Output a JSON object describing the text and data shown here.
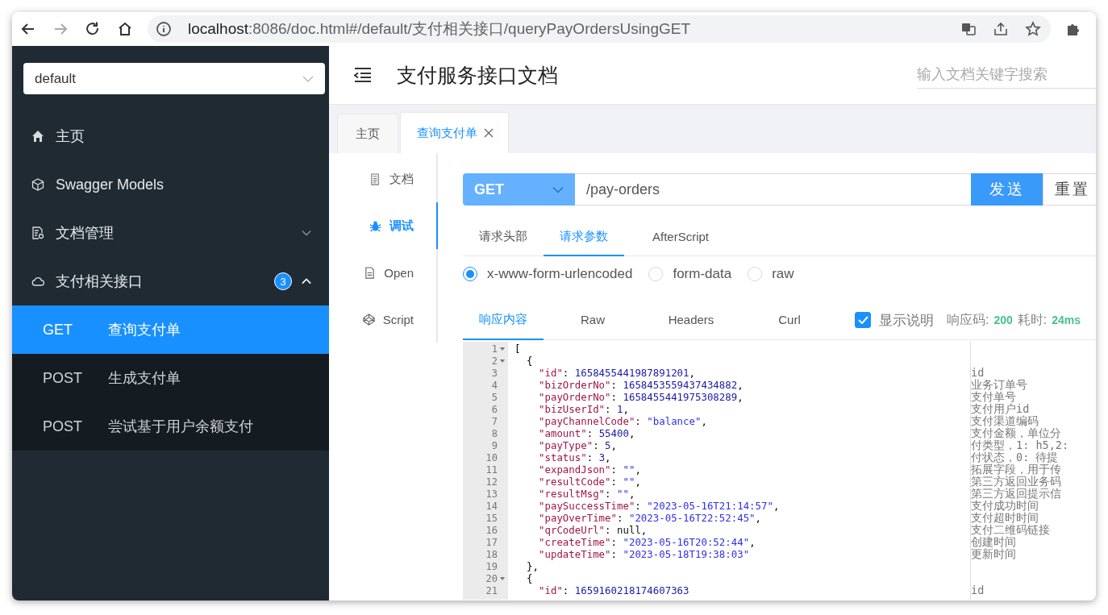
{
  "browser": {
    "url_host": "localhost",
    "url_rest": ":8086/doc.html#/default/支付相关接口/queryPayOrdersUsingGET"
  },
  "sidebar": {
    "group_select": "default",
    "menu": [
      {
        "label": "主页"
      },
      {
        "label": "Swagger Models"
      },
      {
        "label": "文档管理",
        "expanded": false
      },
      {
        "label": "支付相关接口",
        "badge": "3",
        "expanded": true,
        "children": [
          {
            "method": "GET",
            "label": "查询支付单",
            "selected": true
          },
          {
            "method": "POST",
            "label": "生成支付单",
            "selected": false
          },
          {
            "method": "POST",
            "label": "尝试基于用户余额支付",
            "selected": false
          }
        ]
      }
    ]
  },
  "header": {
    "title": "支付服务接口文档",
    "search_placeholder": "输入文档关键字搜索"
  },
  "tabs": [
    {
      "label": "主页",
      "selected": false,
      "closable": false
    },
    {
      "label": "查询支付单",
      "selected": true,
      "closable": true
    }
  ],
  "side_tabs": [
    {
      "label": "文档",
      "selected": false
    },
    {
      "label": "调试",
      "selected": true
    },
    {
      "label": "Open",
      "selected": false
    },
    {
      "label": "Script",
      "selected": false
    }
  ],
  "request": {
    "method": "GET",
    "path": "/pay-orders",
    "buttons": [
      {
        "label": "发送",
        "kind": "primary"
      },
      {
        "label": "重置",
        "kind": "default"
      }
    ],
    "tabs": [
      {
        "label": "请求头部",
        "selected": false
      },
      {
        "label": "请求参数",
        "selected": true
      },
      {
        "label": "AfterScript",
        "selected": false
      }
    ],
    "body_types": [
      {
        "label": "x-www-form-urlencoded",
        "selected": true
      },
      {
        "label": "form-data",
        "selected": false
      },
      {
        "label": "raw",
        "selected": false
      }
    ]
  },
  "response": {
    "tabs": [
      {
        "label": "响应内容",
        "selected": true
      },
      {
        "label": "Raw",
        "selected": false
      },
      {
        "label": "Headers",
        "selected": false
      },
      {
        "label": "Curl",
        "selected": false
      }
    ],
    "show_notes": {
      "label": "显示说明",
      "checked": true
    },
    "status_label": "响应码:",
    "status": "200",
    "time_label": "耗时:",
    "time": "24ms",
    "lines": [
      {
        "number": "1",
        "fold": true,
        "kind": "bracket",
        "tokens": [
          {
            "kind": "plain",
            "text": "["
          }
        ]
      },
      {
        "number": "2",
        "fold": true,
        "kind": "brace",
        "tokens": [
          {
            "kind": "plain",
            "text": "{"
          }
        ]
      },
      {
        "number": "3",
        "fold": false,
        "kind": "field",
        "tokens": [
          {
            "kind": "key",
            "text": "\"id\""
          },
          {
            "kind": "plain",
            "text": ":"
          },
          {
            "kind": "number",
            "text": "1658455441987891201"
          },
          {
            "kind": "plain",
            "text": ","
          }
        ],
        "note": "id"
      },
      {
        "number": "4",
        "fold": false,
        "kind": "field",
        "tokens": [
          {
            "kind": "key",
            "text": "\"bizOrderNo\""
          },
          {
            "kind": "plain",
            "text": ":"
          },
          {
            "kind": "number",
            "text": "1658453559437434882"
          },
          {
            "kind": "plain",
            "text": ","
          }
        ],
        "note": "业务订单号"
      },
      {
        "number": "5",
        "fold": false,
        "kind": "field",
        "tokens": [
          {
            "kind": "key",
            "text": "\"payOrderNo\""
          },
          {
            "kind": "plain",
            "text": ":"
          },
          {
            "kind": "number",
            "text": "1658455441975308289"
          },
          {
            "kind": "plain",
            "text": ","
          }
        ],
        "note": "支付单号"
      },
      {
        "number": "6",
        "fold": false,
        "kind": "field",
        "tokens": [
          {
            "kind": "key",
            "text": "\"bizUserId\""
          },
          {
            "kind": "plain",
            "text": ":"
          },
          {
            "kind": "number",
            "text": "1"
          },
          {
            "kind": "plain",
            "text": ","
          }
        ],
        "note": "支付用户id"
      },
      {
        "number": "7",
        "fold": false,
        "kind": "field",
        "tokens": [
          {
            "kind": "key",
            "text": "\"payChannelCode\""
          },
          {
            "kind": "plain",
            "text": ":"
          },
          {
            "kind": "string",
            "text": "\"balance\""
          },
          {
            "kind": "plain",
            "text": ","
          }
        ],
        "note": "支付渠道编码"
      },
      {
        "number": "8",
        "fold": false,
        "kind": "field",
        "tokens": [
          {
            "kind": "key",
            "text": "\"amount\""
          },
          {
            "kind": "plain",
            "text": ":"
          },
          {
            "kind": "number",
            "text": "55400"
          },
          {
            "kind": "plain",
            "text": ","
          }
        ],
        "note": "支付金额，单位分"
      },
      {
        "number": "9",
        "fold": false,
        "kind": "field",
        "tokens": [
          {
            "kind": "key",
            "text": "\"payType\""
          },
          {
            "kind": "plain",
            "text": ":"
          },
          {
            "kind": "number",
            "text": "5"
          },
          {
            "kind": "plain",
            "text": ","
          }
        ],
        "note": "付类型，1: h5,2:"
      },
      {
        "number": "10",
        "fold": false,
        "kind": "field",
        "tokens": [
          {
            "kind": "key",
            "text": "\"status\""
          },
          {
            "kind": "plain",
            "text": ":"
          },
          {
            "kind": "number",
            "text": "3"
          },
          {
            "kind": "plain",
            "text": ","
          }
        ],
        "note": "付状态，0: 待提"
      },
      {
        "number": "11",
        "fold": false,
        "kind": "field",
        "tokens": [
          {
            "kind": "key",
            "text": "\"expandJson\""
          },
          {
            "kind": "plain",
            "text": ":"
          },
          {
            "kind": "string",
            "text": "\"\""
          },
          {
            "kind": "plain",
            "text": ","
          }
        ],
        "note": "拓展字段，用于传"
      },
      {
        "number": "12",
        "fold": false,
        "kind": "field",
        "tokens": [
          {
            "kind": "key",
            "text": "\"resultCode\""
          },
          {
            "kind": "plain",
            "text": ":"
          },
          {
            "kind": "string",
            "text": "\"\""
          },
          {
            "kind": "plain",
            "text": ","
          }
        ],
        "note": "第三方返回业务码"
      },
      {
        "number": "13",
        "fold": false,
        "kind": "field",
        "tokens": [
          {
            "kind": "key",
            "text": "\"resultMsg\""
          },
          {
            "kind": "plain",
            "text": ":"
          },
          {
            "kind": "string",
            "text": "\"\""
          },
          {
            "kind": "plain",
            "text": ","
          }
        ],
        "note": "第三方返回提示信"
      },
      {
        "number": "14",
        "fold": false,
        "kind": "field",
        "tokens": [
          {
            "kind": "key",
            "text": "\"paySuccessTime\""
          },
          {
            "kind": "plain",
            "text": ":"
          },
          {
            "kind": "string",
            "text": "\"2023-05-16T21:14:57\""
          },
          {
            "kind": "plain",
            "text": ","
          }
        ],
        "note": "支付成功时间"
      },
      {
        "number": "15",
        "fold": false,
        "kind": "field",
        "tokens": [
          {
            "kind": "key",
            "text": "\"payOverTime\""
          },
          {
            "kind": "plain",
            "text": ":"
          },
          {
            "kind": "string",
            "text": "\"2023-05-16T22:52:45\""
          },
          {
            "kind": "plain",
            "text": ","
          }
        ],
        "note": "支付超时时间"
      },
      {
        "number": "16",
        "fold": false,
        "kind": "field",
        "tokens": [
          {
            "kind": "key",
            "text": "\"qrCodeUrl\""
          },
          {
            "kind": "plain",
            "text": ":"
          },
          {
            "kind": "null",
            "text": "null"
          },
          {
            "kind": "plain",
            "text": ","
          }
        ],
        "note": "支付二维码链接"
      },
      {
        "number": "17",
        "fold": false,
        "kind": "field",
        "tokens": [
          {
            "kind": "key",
            "text": "\"createTime\""
          },
          {
            "kind": "plain",
            "text": ":"
          },
          {
            "kind": "string",
            "text": "\"2023-05-16T20:52:44\""
          },
          {
            "kind": "plain",
            "text": ","
          }
        ],
        "note": "创建时间"
      },
      {
        "number": "18",
        "fold": false,
        "kind": "field",
        "tokens": [
          {
            "kind": "key",
            "text": "\"updateTime\""
          },
          {
            "kind": "plain",
            "text": ":"
          },
          {
            "kind": "string",
            "text": "\"2023-05-18T19:38:03\""
          }
        ],
        "note": "更新时间"
      },
      {
        "number": "19",
        "fold": false,
        "kind": "brace",
        "tokens": [
          {
            "kind": "plain",
            "text": "},"
          }
        ]
      },
      {
        "number": "20",
        "fold": true,
        "kind": "brace",
        "tokens": [
          {
            "kind": "plain",
            "text": "{"
          }
        ]
      },
      {
        "number": "21",
        "fold": false,
        "kind": "field",
        "tokens": [
          {
            "kind": "key",
            "text": "\"id\""
          },
          {
            "kind": "plain",
            "text": ":"
          },
          {
            "kind": "number",
            "text": "1659160218174607363"
          }
        ],
        "note": "id"
      }
    ]
  }
}
